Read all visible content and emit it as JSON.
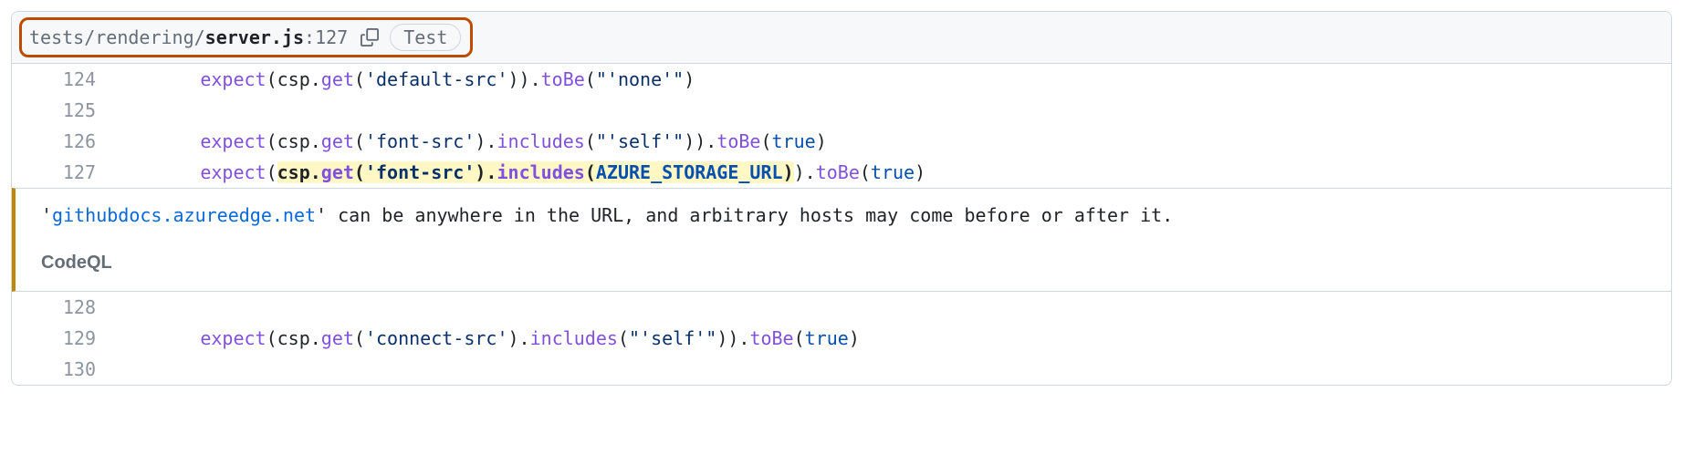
{
  "header": {
    "path_prefix": "tests/rendering/",
    "file_bold": "server.js",
    "colon": ":",
    "line_number": "127",
    "pill_label": "Test"
  },
  "code": {
    "rows": [
      {
        "num": "124",
        "indent": "        ",
        "tokens": [
          {
            "cls": "tok-fn",
            "t": "expect"
          },
          {
            "cls": "tok-plain",
            "t": "(csp."
          },
          {
            "cls": "tok-fn",
            "t": "get"
          },
          {
            "cls": "tok-plain",
            "t": "("
          },
          {
            "cls": "tok-str",
            "t": "'default-src'"
          },
          {
            "cls": "tok-plain",
            "t": "))."
          },
          {
            "cls": "tok-fn",
            "t": "toBe"
          },
          {
            "cls": "tok-plain",
            "t": "("
          },
          {
            "cls": "tok-str",
            "t": "\"'none'\""
          },
          {
            "cls": "tok-plain",
            "t": ")"
          }
        ]
      },
      {
        "num": "125",
        "indent": "",
        "tokens": []
      },
      {
        "num": "126",
        "indent": "        ",
        "tokens": [
          {
            "cls": "tok-fn",
            "t": "expect"
          },
          {
            "cls": "tok-plain",
            "t": "(csp."
          },
          {
            "cls": "tok-fn",
            "t": "get"
          },
          {
            "cls": "tok-plain",
            "t": "("
          },
          {
            "cls": "tok-str",
            "t": "'font-src'"
          },
          {
            "cls": "tok-plain",
            "t": ")."
          },
          {
            "cls": "tok-fn",
            "t": "includes"
          },
          {
            "cls": "tok-plain",
            "t": "("
          },
          {
            "cls": "tok-str",
            "t": "\"'self'\""
          },
          {
            "cls": "tok-plain",
            "t": "))."
          },
          {
            "cls": "tok-fn",
            "t": "toBe"
          },
          {
            "cls": "tok-plain",
            "t": "("
          },
          {
            "cls": "tok-const",
            "t": "true"
          },
          {
            "cls": "tok-plain",
            "t": ")"
          }
        ]
      },
      {
        "num": "127",
        "indent": "        ",
        "tokens": [
          {
            "cls": "tok-fn",
            "t": "expect"
          },
          {
            "cls": "tok-plain",
            "t": "("
          },
          {
            "cls": "hl",
            "inner": [
              {
                "cls": "tok-plain bold-code",
                "t": "csp"
              },
              {
                "cls": "tok-plain bold-code",
                "t": "."
              },
              {
                "cls": "tok-fn bold-code",
                "t": "get"
              },
              {
                "cls": "tok-plain bold-code",
                "t": "("
              },
              {
                "cls": "tok-str bold-code",
                "t": "'font-src'"
              },
              {
                "cls": "tok-plain bold-code",
                "t": ")."
              },
              {
                "cls": "tok-fn bold-code",
                "t": "includes"
              },
              {
                "cls": "tok-plain bold-code",
                "t": "("
              },
              {
                "cls": "tok-const bold-code",
                "t": "AZURE_STORAGE_URL"
              },
              {
                "cls": "tok-plain bold-code",
                "t": ")"
              }
            ]
          },
          {
            "cls": "tok-plain",
            "t": ")."
          },
          {
            "cls": "tok-fn",
            "t": "toBe"
          },
          {
            "cls": "tok-plain",
            "t": "("
          },
          {
            "cls": "tok-const",
            "t": "true"
          },
          {
            "cls": "tok-plain",
            "t": ")"
          }
        ]
      }
    ],
    "rows_after": [
      {
        "num": "128",
        "indent": "",
        "tokens": []
      },
      {
        "num": "129",
        "indent": "        ",
        "tokens": [
          {
            "cls": "tok-fn",
            "t": "expect"
          },
          {
            "cls": "tok-plain",
            "t": "(csp."
          },
          {
            "cls": "tok-fn",
            "t": "get"
          },
          {
            "cls": "tok-plain",
            "t": "("
          },
          {
            "cls": "tok-str",
            "t": "'connect-src'"
          },
          {
            "cls": "tok-plain",
            "t": ")."
          },
          {
            "cls": "tok-fn",
            "t": "includes"
          },
          {
            "cls": "tok-plain",
            "t": "("
          },
          {
            "cls": "tok-str",
            "t": "\"'self'\""
          },
          {
            "cls": "tok-plain",
            "t": "))."
          },
          {
            "cls": "tok-fn",
            "t": "toBe"
          },
          {
            "cls": "tok-plain",
            "t": "("
          },
          {
            "cls": "tok-const",
            "t": "true"
          },
          {
            "cls": "tok-plain",
            "t": ")"
          }
        ]
      },
      {
        "num": "130",
        "indent": "",
        "tokens": []
      }
    ]
  },
  "alert": {
    "quote_open": "'",
    "link_text": "githubdocs.azureedge.net",
    "quote_close": "'",
    "rest": " can be anywhere in the URL, and arbitrary hosts may come before or after it.",
    "tool": "CodeQL"
  }
}
